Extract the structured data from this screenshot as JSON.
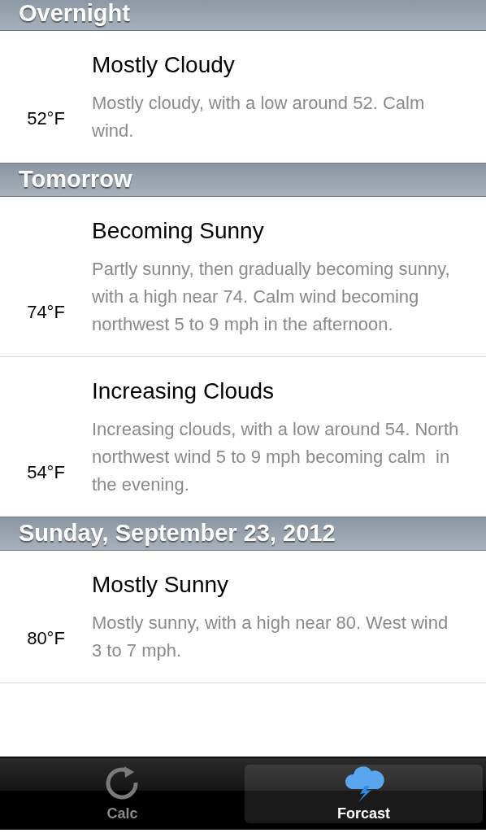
{
  "sections": [
    {
      "title": "Overnight",
      "rows": [
        {
          "temp": "52°F",
          "title": "Mostly Cloudy",
          "description": "Mostly cloudy, with a low around 52. Calm wind."
        }
      ]
    },
    {
      "title": "Tomorrow",
      "rows": [
        {
          "temp": "74°F",
          "title": "Becoming Sunny",
          "description": "Partly sunny, then gradually becoming sunny, with a high near 74. Calm wind becoming northwest 5 to 9 mph in the afternoon."
        },
        {
          "temp": "54°F",
          "title": "Increasing Clouds",
          "description": "Increasing clouds, with a low around 54. North northwest wind 5 to 9 mph becoming calm  in the evening."
        }
      ]
    },
    {
      "title": "Sunday, September 23, 2012",
      "rows": [
        {
          "temp": "80°F",
          "title": "Mostly Sunny",
          "description": "Mostly sunny, with a high near 80. West wind 3 to 7 mph."
        }
      ]
    }
  ],
  "tabs": [
    {
      "label": "Calc",
      "kind": "refresh",
      "selected": false
    },
    {
      "label": "Forcast",
      "kind": "weather",
      "selected": true
    }
  ]
}
